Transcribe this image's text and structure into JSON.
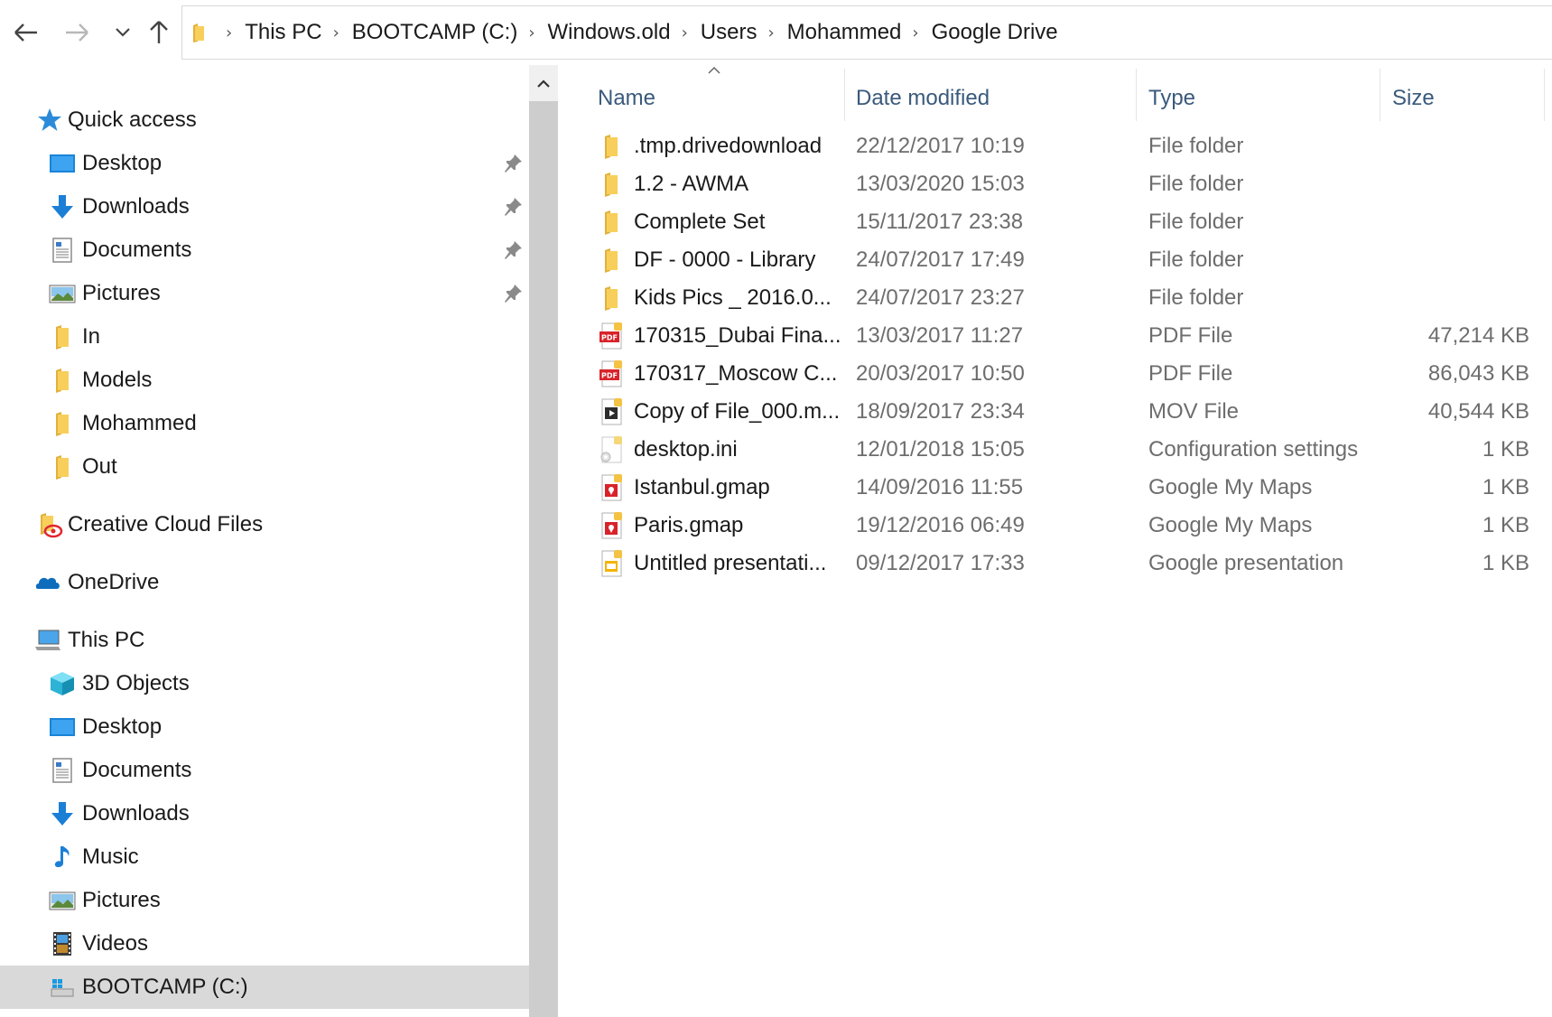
{
  "toolbar": {
    "back_icon": "back-arrow-icon",
    "forward_icon": "forward-arrow-icon",
    "recent_icon": "chevron-down-icon",
    "up_icon": "up-arrow-icon"
  },
  "breadcrumb": [
    "This PC",
    "BOOTCAMP (C:)",
    "Windows.old",
    "Users",
    "Mohammed",
    "Google Drive"
  ],
  "nav": {
    "quick_access": "Quick access",
    "quick_items": [
      {
        "label": "Desktop",
        "icon": "desktop-icon",
        "pinned": true
      },
      {
        "label": "Downloads",
        "icon": "downloads-icon",
        "pinned": true
      },
      {
        "label": "Documents",
        "icon": "documents-icon",
        "pinned": true
      },
      {
        "label": "Pictures",
        "icon": "pictures-icon",
        "pinned": true
      },
      {
        "label": "In",
        "icon": "folder-icon",
        "pinned": false
      },
      {
        "label": "Models",
        "icon": "folder-icon",
        "pinned": false
      },
      {
        "label": "Mohammed",
        "icon": "folder-icon",
        "pinned": false
      },
      {
        "label": "Out",
        "icon": "folder-icon",
        "pinned": false
      }
    ],
    "creative_cloud": "Creative Cloud Files",
    "onedrive": "OneDrive",
    "this_pc": "This PC",
    "pc_items": [
      {
        "label": "3D Objects",
        "icon": "3d-objects-icon"
      },
      {
        "label": "Desktop",
        "icon": "desktop-icon"
      },
      {
        "label": "Documents",
        "icon": "documents-icon"
      },
      {
        "label": "Downloads",
        "icon": "downloads-icon"
      },
      {
        "label": "Music",
        "icon": "music-icon"
      },
      {
        "label": "Pictures",
        "icon": "pictures-icon"
      },
      {
        "label": "Videos",
        "icon": "videos-icon"
      },
      {
        "label": "BOOTCAMP (C:)",
        "icon": "drive-icon"
      }
    ]
  },
  "columns": {
    "name": "Name",
    "date": "Date modified",
    "type": "Type",
    "size": "Size"
  },
  "files": [
    {
      "name": ".tmp.drivedownload",
      "date": "22/12/2017 10:19",
      "type": "File folder",
      "size": "",
      "icon": "folder-icon"
    },
    {
      "name": "1.2 - AWMA",
      "date": "13/03/2020 15:03",
      "type": "File folder",
      "size": "",
      "icon": "folder-icon"
    },
    {
      "name": "Complete Set",
      "date": "15/11/2017 23:38",
      "type": "File folder",
      "size": "",
      "icon": "folder-icon"
    },
    {
      "name": "DF - 0000 - Library",
      "date": "24/07/2017 17:49",
      "type": "File folder",
      "size": "",
      "icon": "folder-icon"
    },
    {
      "name": "Kids Pics _  2016.0...",
      "date": "24/07/2017 23:27",
      "type": "File folder",
      "size": "",
      "icon": "folder-icon"
    },
    {
      "name": "170315_Dubai Fina...",
      "date": "13/03/2017 11:27",
      "type": "PDF File",
      "size": "47,214 KB",
      "icon": "pdf-icon"
    },
    {
      "name": "170317_Moscow C...",
      "date": "20/03/2017 10:50",
      "type": "PDF File",
      "size": "86,043 KB",
      "icon": "pdf-icon"
    },
    {
      "name": "Copy of File_000.m...",
      "date": "18/09/2017 23:34",
      "type": "MOV File",
      "size": "40,544 KB",
      "icon": "video-file-icon"
    },
    {
      "name": "desktop.ini",
      "date": "12/01/2018 15:05",
      "type": "Configuration settings",
      "size": "1 KB",
      "icon": "settings-file-icon"
    },
    {
      "name": "Istanbul.gmap",
      "date": "14/09/2016 11:55",
      "type": "Google My Maps",
      "size": "1 KB",
      "icon": "gmap-icon"
    },
    {
      "name": "Paris.gmap",
      "date": "19/12/2016 06:49",
      "type": "Google My Maps",
      "size": "1 KB",
      "icon": "gmap-icon"
    },
    {
      "name": "Untitled presentati...",
      "date": "09/12/2017 17:33",
      "type": "Google presentation",
      "size": "1 KB",
      "icon": "gslides-icon"
    }
  ],
  "colors": {
    "header_text": "#3a5a7c",
    "folder": "#f8cf5b",
    "selection": "#d9d9d9",
    "pdf_red": "#d8232a"
  }
}
